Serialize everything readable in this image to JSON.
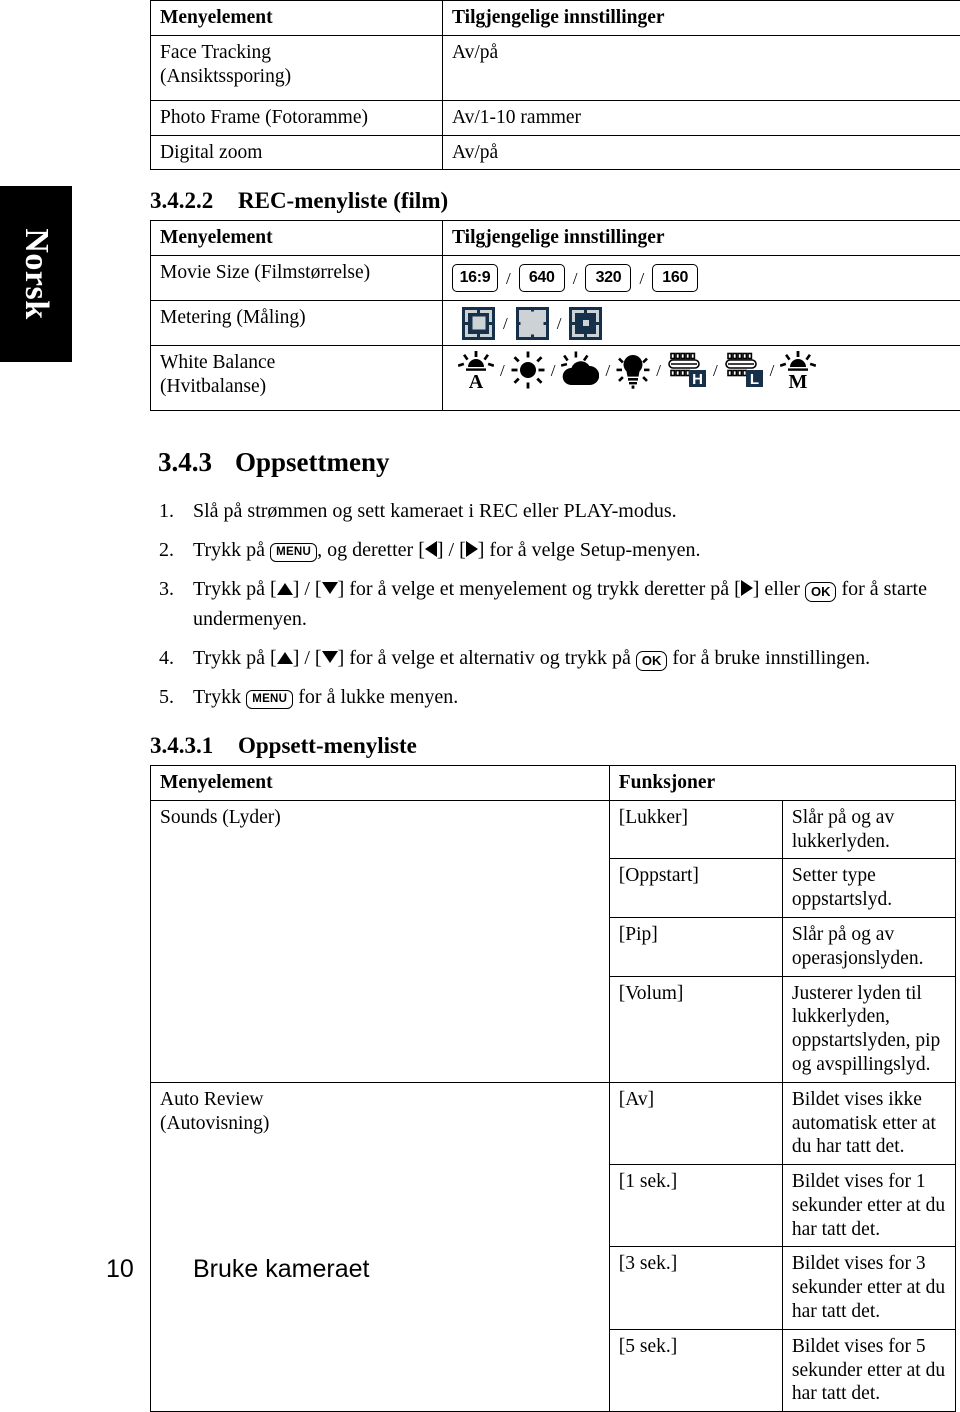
{
  "language_tab": {
    "label": "Norsk"
  },
  "table_rec_photo": {
    "headers": [
      "Menyelement",
      "Tilgjengelige innstillinger"
    ],
    "rows": [
      {
        "item": "Face Tracking\n(Ansiktssporing)",
        "item_line1": "Face Tracking",
        "item_line2": "(Ansiktssporing)",
        "settings": "Av/på"
      },
      {
        "item_line1": "Photo Frame (Fotoramme)",
        "item_line2": "",
        "settings": "Av/1-10 rammer"
      },
      {
        "item_line1": "Digital zoom",
        "item_line2": "",
        "settings": "Av/på"
      }
    ]
  },
  "section_rec_movie": {
    "number": "3.4.2.2",
    "title": "REC-menyliste (film)",
    "headers": [
      "Menyelement",
      "Tilgjengelige innstillinger"
    ],
    "rows": [
      {
        "item_line1": "Movie Size (Filmstørrelse)",
        "item_line2": "",
        "icon_type": "size-badges",
        "options": [
          "16:9",
          "640",
          "320",
          "160"
        ],
        "separator": "/"
      },
      {
        "item_line1": "Metering (Måling)",
        "item_line2": "",
        "icon_type": "metering",
        "options": [
          "metering-center-icon",
          "metering-average-icon",
          "metering-spot-icon"
        ],
        "separator": "/"
      },
      {
        "item_line1": "White Balance",
        "item_line2": "(Hvitbalanse)",
        "icon_type": "white-balance",
        "options": [
          "wb-auto-icon",
          "wb-daylight-icon",
          "wb-cloudy-icon",
          "wb-tungsten-icon",
          "wb-fluorescent-h-icon",
          "wb-fluorescent-l-icon",
          "wb-manual-icon"
        ],
        "separator": "/"
      }
    ]
  },
  "section_setup": {
    "number": "3.4.3",
    "title": "Oppsettmeny",
    "steps": [
      {
        "index": "1.",
        "parts": [
          {
            "t": "text",
            "v": "Slå på strømmen og sett kameraet i REC eller PLAY-modus."
          }
        ]
      },
      {
        "index": "2.",
        "parts": [
          {
            "t": "text",
            "v": "Trykk på "
          },
          {
            "t": "key",
            "v": "MENU"
          },
          {
            "t": "text",
            "v": ", og deretter ["
          },
          {
            "t": "tri-l",
            "v": ""
          },
          {
            "t": "text",
            "v": "] / ["
          },
          {
            "t": "tri-r",
            "v": ""
          },
          {
            "t": "text",
            "v": "] for å velge Setup-menyen."
          }
        ]
      },
      {
        "index": "3.",
        "parts": [
          {
            "t": "text",
            "v": "Trykk på ["
          },
          {
            "t": "tri-u",
            "v": ""
          },
          {
            "t": "text",
            "v": "] / ["
          },
          {
            "t": "tri-d",
            "v": ""
          },
          {
            "t": "text",
            "v": "] for å velge et menyelement og trykk deretter på ["
          },
          {
            "t": "tri-r",
            "v": ""
          },
          {
            "t": "text",
            "v": "] eller "
          },
          {
            "t": "ok",
            "v": "OK"
          },
          {
            "t": "text",
            "v": " for å starte undermenyen."
          }
        ]
      },
      {
        "index": "4.",
        "parts": [
          {
            "t": "text",
            "v": "Trykk på ["
          },
          {
            "t": "tri-u",
            "v": ""
          },
          {
            "t": "text",
            "v": "] / ["
          },
          {
            "t": "tri-d",
            "v": ""
          },
          {
            "t": "text",
            "v": "] for å velge et alternativ og trykk på "
          },
          {
            "t": "ok",
            "v": "OK"
          },
          {
            "t": "text",
            "v": " for å bruke innstillingen."
          }
        ]
      },
      {
        "index": "5.",
        "parts": [
          {
            "t": "text",
            "v": "Trykk "
          },
          {
            "t": "key",
            "v": "MENU"
          },
          {
            "t": "text",
            "v": " for å lukke menyen."
          }
        ]
      }
    ]
  },
  "section_setup_list": {
    "number": "3.4.3.1",
    "title": "Oppsett-menyliste",
    "headers": [
      "Menyelement",
      "Funksjoner"
    ],
    "rows": [
      {
        "item": "Sounds (Lyder)",
        "item_rowspan": 4,
        "option": "[Lukker]",
        "description": "Slår på og av lukkerlyden."
      },
      {
        "item": "",
        "option": "[Oppstart]",
        "description": "Setter type oppstartslyd."
      },
      {
        "item": "",
        "option": "[Pip]",
        "description": "Slår på og av operasjonslyden."
      },
      {
        "item": "",
        "option": "[Volum]",
        "description": "Justerer lyden til lukkerlyden, oppstartslyden, pip og avspillingslyd."
      },
      {
        "item": "Auto Review\n(Autovisning)",
        "item_line1": "Auto Review",
        "item_line2": "(Autovisning)",
        "item_rowspan": 4,
        "option": "[Av]",
        "description": "Bildet vises ikke automatisk etter at du har tatt det."
      },
      {
        "item": "",
        "option": "[1 sek.]",
        "description": "Bildet vises for 1 sekunder etter at du har tatt det."
      },
      {
        "item": "",
        "option": "[3 sek.]",
        "description": "Bildet vises for 3 sekunder etter at du har tatt det."
      },
      {
        "item": "",
        "option": "[5 sek.]",
        "description": "Bildet vises for 5 sekunder etter at du har tatt det."
      }
    ]
  },
  "footer": {
    "page_number": "10",
    "title": "Bruke kameraet"
  },
  "colors": {
    "metering_dark": "#16304a",
    "metering_light": "#ccd2d6",
    "tab_bg": "#000000",
    "tab_text": "#ffffff"
  }
}
